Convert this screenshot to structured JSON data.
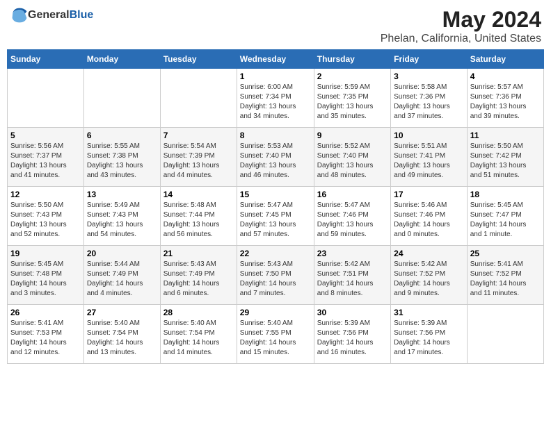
{
  "header": {
    "logo_general": "General",
    "logo_blue": "Blue",
    "month_title": "May 2024",
    "location": "Phelan, California, United States"
  },
  "weekdays": [
    "Sunday",
    "Monday",
    "Tuesday",
    "Wednesday",
    "Thursday",
    "Friday",
    "Saturday"
  ],
  "weeks": [
    [
      {
        "day": "",
        "info": ""
      },
      {
        "day": "",
        "info": ""
      },
      {
        "day": "",
        "info": ""
      },
      {
        "day": "1",
        "info": "Sunrise: 6:00 AM\nSunset: 7:34 PM\nDaylight: 13 hours\nand 34 minutes."
      },
      {
        "day": "2",
        "info": "Sunrise: 5:59 AM\nSunset: 7:35 PM\nDaylight: 13 hours\nand 35 minutes."
      },
      {
        "day": "3",
        "info": "Sunrise: 5:58 AM\nSunset: 7:36 PM\nDaylight: 13 hours\nand 37 minutes."
      },
      {
        "day": "4",
        "info": "Sunrise: 5:57 AM\nSunset: 7:36 PM\nDaylight: 13 hours\nand 39 minutes."
      }
    ],
    [
      {
        "day": "5",
        "info": "Sunrise: 5:56 AM\nSunset: 7:37 PM\nDaylight: 13 hours\nand 41 minutes."
      },
      {
        "day": "6",
        "info": "Sunrise: 5:55 AM\nSunset: 7:38 PM\nDaylight: 13 hours\nand 43 minutes."
      },
      {
        "day": "7",
        "info": "Sunrise: 5:54 AM\nSunset: 7:39 PM\nDaylight: 13 hours\nand 44 minutes."
      },
      {
        "day": "8",
        "info": "Sunrise: 5:53 AM\nSunset: 7:40 PM\nDaylight: 13 hours\nand 46 minutes."
      },
      {
        "day": "9",
        "info": "Sunrise: 5:52 AM\nSunset: 7:40 PM\nDaylight: 13 hours\nand 48 minutes."
      },
      {
        "day": "10",
        "info": "Sunrise: 5:51 AM\nSunset: 7:41 PM\nDaylight: 13 hours\nand 49 minutes."
      },
      {
        "day": "11",
        "info": "Sunrise: 5:50 AM\nSunset: 7:42 PM\nDaylight: 13 hours\nand 51 minutes."
      }
    ],
    [
      {
        "day": "12",
        "info": "Sunrise: 5:50 AM\nSunset: 7:43 PM\nDaylight: 13 hours\nand 52 minutes."
      },
      {
        "day": "13",
        "info": "Sunrise: 5:49 AM\nSunset: 7:43 PM\nDaylight: 13 hours\nand 54 minutes."
      },
      {
        "day": "14",
        "info": "Sunrise: 5:48 AM\nSunset: 7:44 PM\nDaylight: 13 hours\nand 56 minutes."
      },
      {
        "day": "15",
        "info": "Sunrise: 5:47 AM\nSunset: 7:45 PM\nDaylight: 13 hours\nand 57 minutes."
      },
      {
        "day": "16",
        "info": "Sunrise: 5:47 AM\nSunset: 7:46 PM\nDaylight: 13 hours\nand 59 minutes."
      },
      {
        "day": "17",
        "info": "Sunrise: 5:46 AM\nSunset: 7:46 PM\nDaylight: 14 hours\nand 0 minutes."
      },
      {
        "day": "18",
        "info": "Sunrise: 5:45 AM\nSunset: 7:47 PM\nDaylight: 14 hours\nand 1 minute."
      }
    ],
    [
      {
        "day": "19",
        "info": "Sunrise: 5:45 AM\nSunset: 7:48 PM\nDaylight: 14 hours\nand 3 minutes."
      },
      {
        "day": "20",
        "info": "Sunrise: 5:44 AM\nSunset: 7:49 PM\nDaylight: 14 hours\nand 4 minutes."
      },
      {
        "day": "21",
        "info": "Sunrise: 5:43 AM\nSunset: 7:49 PM\nDaylight: 14 hours\nand 6 minutes."
      },
      {
        "day": "22",
        "info": "Sunrise: 5:43 AM\nSunset: 7:50 PM\nDaylight: 14 hours\nand 7 minutes."
      },
      {
        "day": "23",
        "info": "Sunrise: 5:42 AM\nSunset: 7:51 PM\nDaylight: 14 hours\nand 8 minutes."
      },
      {
        "day": "24",
        "info": "Sunrise: 5:42 AM\nSunset: 7:52 PM\nDaylight: 14 hours\nand 9 minutes."
      },
      {
        "day": "25",
        "info": "Sunrise: 5:41 AM\nSunset: 7:52 PM\nDaylight: 14 hours\nand 11 minutes."
      }
    ],
    [
      {
        "day": "26",
        "info": "Sunrise: 5:41 AM\nSunset: 7:53 PM\nDaylight: 14 hours\nand 12 minutes."
      },
      {
        "day": "27",
        "info": "Sunrise: 5:40 AM\nSunset: 7:54 PM\nDaylight: 14 hours\nand 13 minutes."
      },
      {
        "day": "28",
        "info": "Sunrise: 5:40 AM\nSunset: 7:54 PM\nDaylight: 14 hours\nand 14 minutes."
      },
      {
        "day": "29",
        "info": "Sunrise: 5:40 AM\nSunset: 7:55 PM\nDaylight: 14 hours\nand 15 minutes."
      },
      {
        "day": "30",
        "info": "Sunrise: 5:39 AM\nSunset: 7:56 PM\nDaylight: 14 hours\nand 16 minutes."
      },
      {
        "day": "31",
        "info": "Sunrise: 5:39 AM\nSunset: 7:56 PM\nDaylight: 14 hours\nand 17 minutes."
      },
      {
        "day": "",
        "info": ""
      }
    ]
  ]
}
